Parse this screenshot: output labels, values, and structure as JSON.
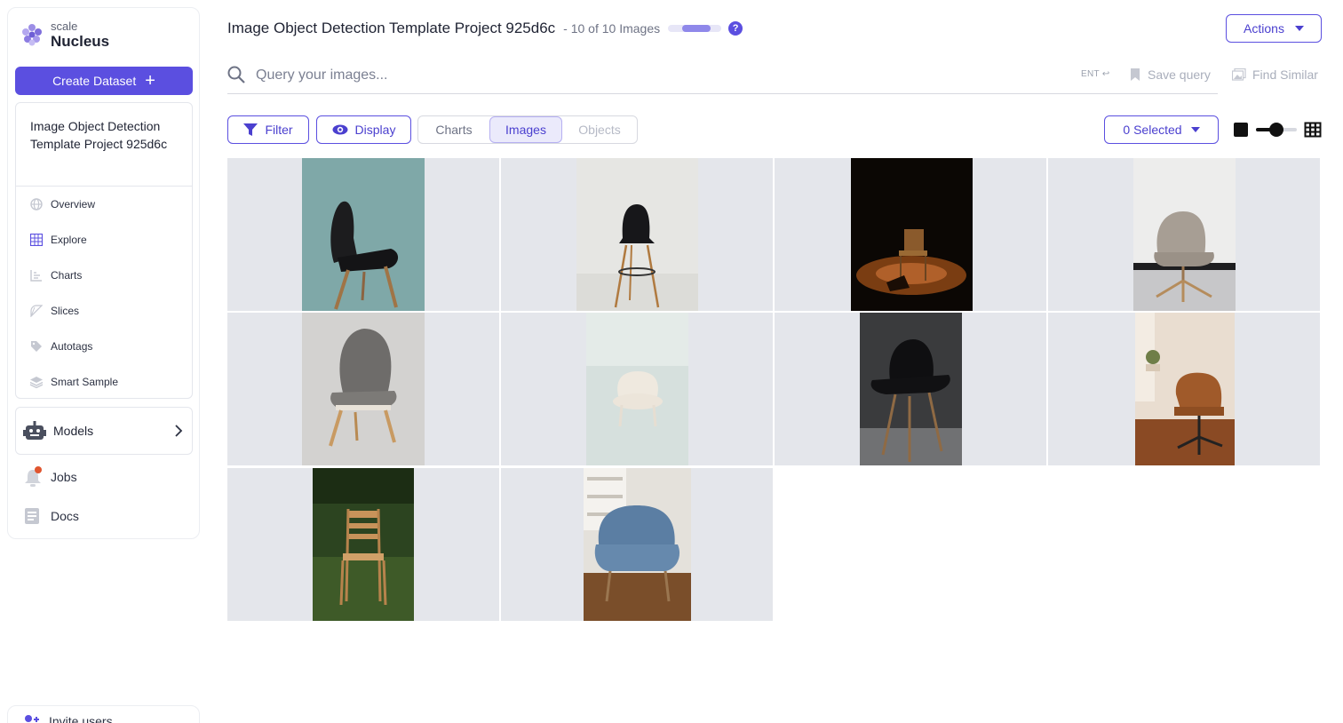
{
  "brand": {
    "small": "scale",
    "big": "Nucleus"
  },
  "sidebar": {
    "create_label": "Create Dataset",
    "project_title": "Image Object Detection Template Project 925d6c",
    "nav": [
      {
        "label": "Overview",
        "icon": "globe-icon"
      },
      {
        "label": "Explore",
        "icon": "grid-icon"
      },
      {
        "label": "Charts",
        "icon": "bar-chart-icon"
      },
      {
        "label": "Slices",
        "icon": "slices-icon"
      },
      {
        "label": "Autotags",
        "icon": "tag-icon"
      },
      {
        "label": "Smart Sample",
        "icon": "layers-icon"
      }
    ],
    "models_label": "Models",
    "jobs_label": "Jobs",
    "docs_label": "Docs",
    "invite_label": "Invite users"
  },
  "header": {
    "title": "Image Object Detection Template Project 925d6c",
    "count": "- 10 of 10 Images",
    "help": "?",
    "actions_label": "Actions"
  },
  "search": {
    "placeholder": "Query your images...",
    "ent_hint": "ENT",
    "save_query_label": "Save query",
    "find_similar_label": "Find Similar"
  },
  "toolbar": {
    "filter_label": "Filter",
    "display_label": "Display",
    "tabs": [
      {
        "label": "Charts",
        "state": "normal"
      },
      {
        "label": "Images",
        "state": "active"
      },
      {
        "label": "Objects",
        "state": "disabled"
      }
    ],
    "selected_label": "0 Selected",
    "size_level": 0.5
  },
  "images": [
    {
      "name": "teal-background-black-chair"
    },
    {
      "name": "black-bar-stool"
    },
    {
      "name": "spotlit-wooden-chair"
    },
    {
      "name": "gray-swivel-chair"
    },
    {
      "name": "gray-upholstered-chair"
    },
    {
      "name": "white-tufted-chair"
    },
    {
      "name": "black-shell-chair"
    },
    {
      "name": "brown-leather-office-chair"
    },
    {
      "name": "wooden-chair-on-grass"
    },
    {
      "name": "blue-armchair"
    }
  ],
  "colors": {
    "accent": "#5b4fe0",
    "notification": "#e0552f"
  }
}
